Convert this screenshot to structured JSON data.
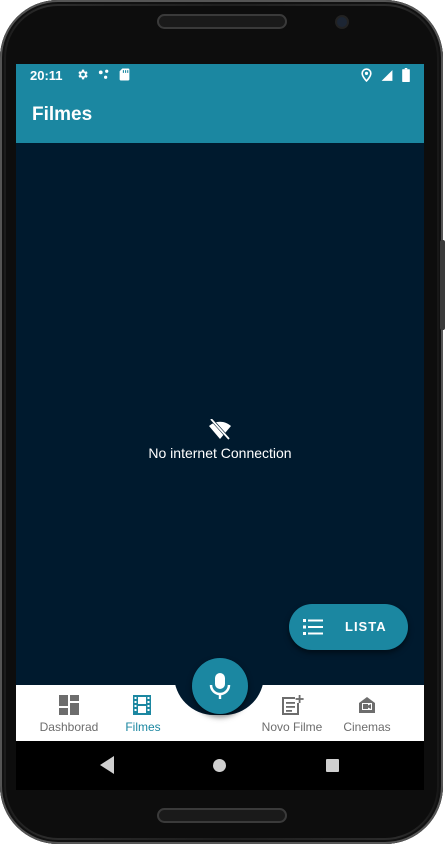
{
  "status_bar": {
    "time": "20:11",
    "left_icons": [
      "gear-icon",
      "dots-icon",
      "sd-card-icon"
    ],
    "right_icons": [
      "location-icon",
      "signal-icon",
      "battery-icon"
    ]
  },
  "app_bar": {
    "title": "Filmes"
  },
  "offline": {
    "icon": "wifi-off-icon",
    "message": "No internet Connection"
  },
  "fab_lista": {
    "icon": "list-icon",
    "label": "LISTA"
  },
  "fab_mic": {
    "icon": "mic-icon"
  },
  "bottom_nav": {
    "items": [
      {
        "label": "Dashborad",
        "icon": "dashboard-icon",
        "active": false
      },
      {
        "label": "Filmes",
        "icon": "film-icon",
        "active": true
      },
      {
        "label": "Novo Filme",
        "icon": "post-add-icon",
        "active": false
      },
      {
        "label": "Cinemas",
        "icon": "cinema-icon",
        "active": false
      }
    ]
  },
  "colors": {
    "primary": "#1b87a1",
    "background": "#001a2e",
    "nav_inactive": "#6d6d6d"
  }
}
